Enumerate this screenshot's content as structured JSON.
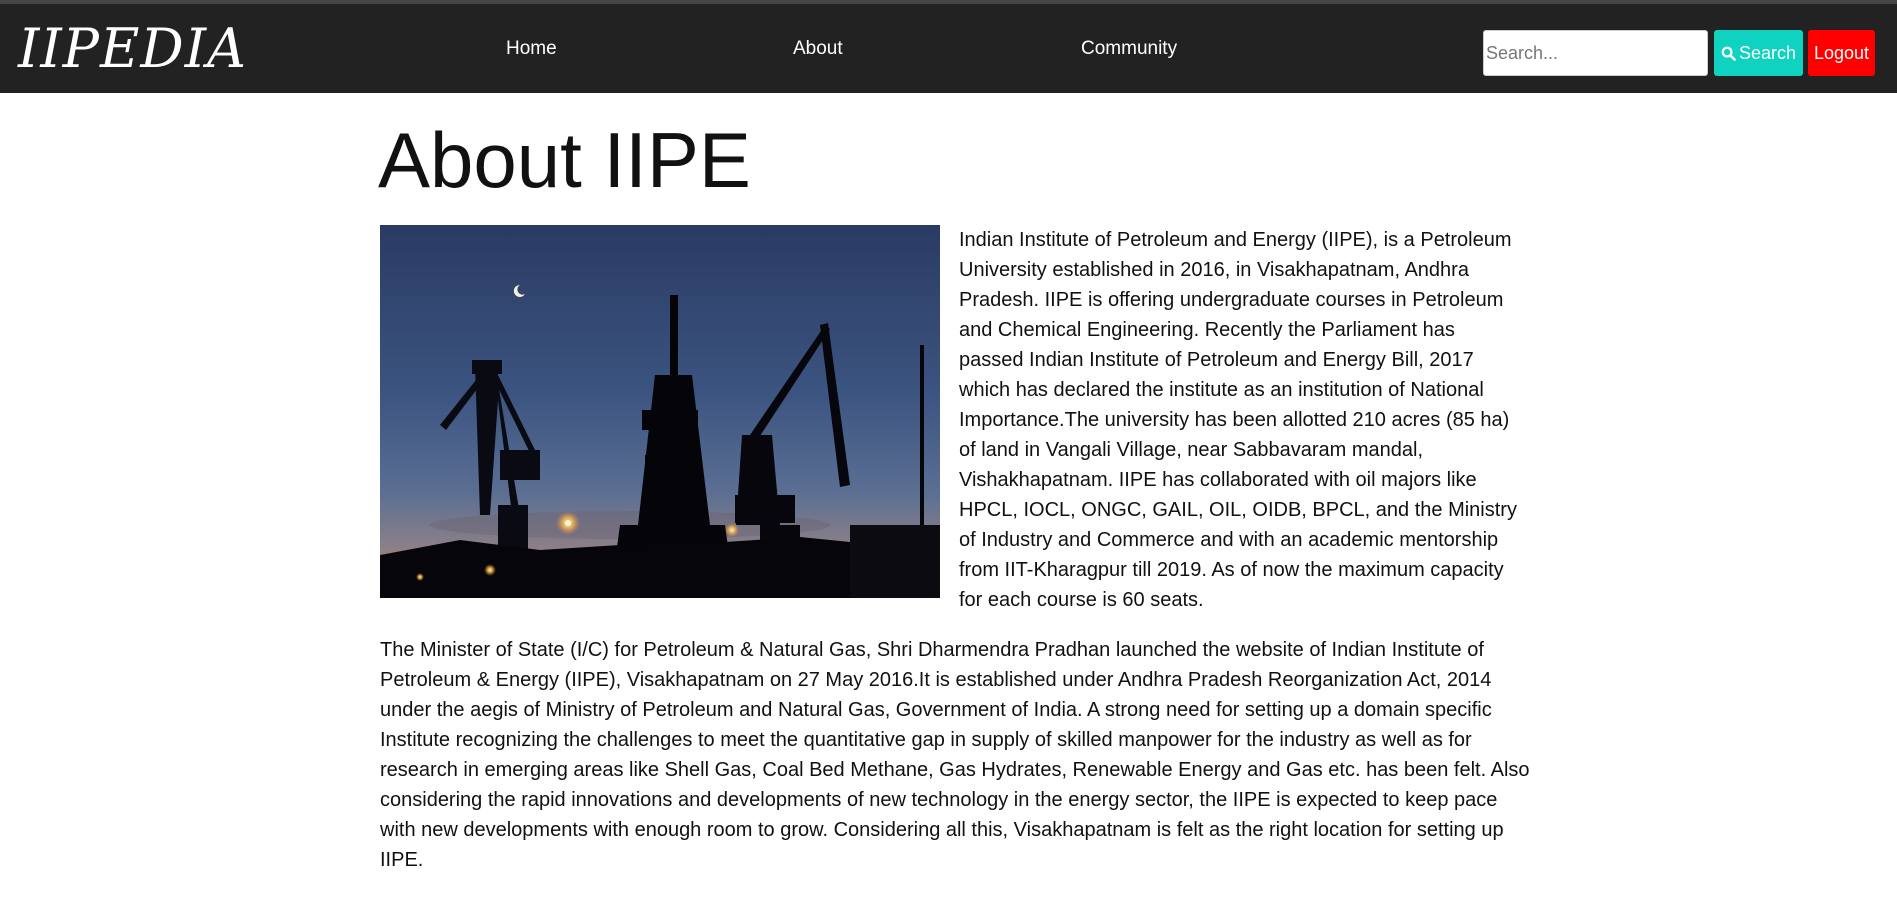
{
  "header": {
    "logo": "IIPEDIA",
    "nav": {
      "home": "Home",
      "about": "About",
      "community": "Community"
    },
    "search": {
      "placeholder": "Search...",
      "value": "",
      "button_label": "Search",
      "button_icon": "search-icon"
    },
    "logout_label": "Logout",
    "colors": {
      "bar": "#222222",
      "search_button": "#10d2c0",
      "logout_button": "#ff0000"
    }
  },
  "main": {
    "title": "About IIPE",
    "paragraph_1": "Indian Institute of Petroleum and Energy (IIPE), is a Petroleum University established in 2016, in Visakhapatnam, Andhra Pradesh. IIPE is offering undergraduate courses in Petroleum and Chemical Engineering. Recently the Parliament has passed Indian Institute of Petroleum and Energy Bill, 2017 which has declared the institute as an institution of National Importance.The university has been allotted 210 acres (85 ha) of land in Vangali Village, near Sabbavaram mandal, Vishakhapatnam. IIPE has collaborated with oil majors like HPCL, IOCL, ONGC, GAIL, OIL, OIDB, BPCL, and the Ministry of Industry and Commerce and with an academic mentorship from IIT-Kharagpur till 2019. As of now the maximum capacity for each course is 60 seats.",
    "paragraph_2": "The Minister of State (I/C) for Petroleum & Natural Gas, Shri Dharmendra Pradhan launched the website of Indian Institute of Petroleum & Energy (IIPE), Visakhapatnam on 27 May 2016.It is established under Andhra Pradesh Reorganization Act, 2014 under the aegis of Ministry of Petroleum and Natural Gas, Government of India. A strong need for setting up a domain specific Institute recognizing the challenges to meet the quantitative gap in supply of skilled manpower for the industry as well as for research in emerging areas like Shell Gas, Coal Bed Methane, Gas Hydrates, Renewable Energy and Gas etc. has been felt. Also considering the rapid innovations and developments of new technology in the energy sector, the IIPE is expected to keep pace with new developments with enough room to grow. Considering all this, Visakhapatnam is felt as the right location for setting up IIPE."
  }
}
